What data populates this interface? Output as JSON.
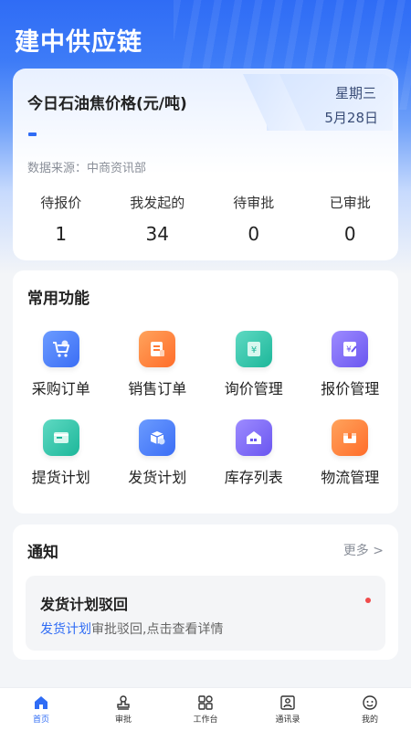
{
  "app": {
    "title": "建中供应链"
  },
  "price_card": {
    "title": "今日石油焦价格(元/吨)",
    "weekday": "星期三",
    "date": "5月28日",
    "value": "-",
    "source": "数据来源：中商资讯部",
    "stats": [
      {
        "label": "待报价",
        "value": "1"
      },
      {
        "label": "我发起的",
        "value": "34"
      },
      {
        "label": "待审批",
        "value": "0"
      },
      {
        "label": "已审批",
        "value": "0"
      }
    ]
  },
  "functions": {
    "title": "常用功能",
    "items": [
      {
        "label": "采购订单",
        "icon": "cart-icon",
        "color": "#3b6ef5"
      },
      {
        "label": "销售订单",
        "icon": "sales-order-icon",
        "color": "#ff6d2a"
      },
      {
        "label": "询价管理",
        "icon": "inquiry-icon",
        "color": "#1db79a"
      },
      {
        "label": "报价管理",
        "icon": "quote-icon",
        "color": "#6a56f0"
      },
      {
        "label": "提货计划",
        "icon": "pickup-icon",
        "color": "#1db79a"
      },
      {
        "label": "发货计划",
        "icon": "shipping-icon",
        "color": "#3b6ef5"
      },
      {
        "label": "库存列表",
        "icon": "warehouse-icon",
        "color": "#6a56f0"
      },
      {
        "label": "物流管理",
        "icon": "logistics-icon",
        "color": "#ff6d2a"
      }
    ]
  },
  "notice": {
    "title": "通知",
    "more": "更多 >",
    "item": {
      "title": "发货计划驳回",
      "link_text": "发货计划",
      "desc": "审批驳回,点击查看详情"
    }
  },
  "tabbar": [
    {
      "label": "首页",
      "icon": "home-icon",
      "active": true
    },
    {
      "label": "审批",
      "icon": "stamp-icon",
      "active": false
    },
    {
      "label": "工作台",
      "icon": "workbench-icon",
      "active": false
    },
    {
      "label": "通讯录",
      "icon": "contacts-icon",
      "active": false
    },
    {
      "label": "我的",
      "icon": "profile-icon",
      "active": false
    }
  ],
  "colors": {
    "primary": "#2f6cf5",
    "badge": "#f04b4b"
  }
}
